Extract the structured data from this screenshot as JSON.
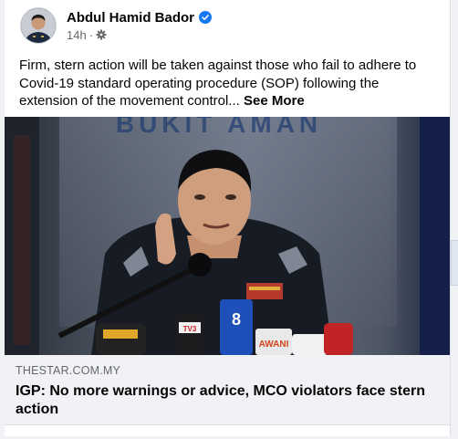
{
  "post": {
    "author": "Abdul Hamid Bador",
    "time": "14h",
    "separator": "·",
    "text": "Firm, stern action will be taken against those who fail to adhere to Covid-19 standard operating procedure (SOP) following the extension of the movement control...",
    "see_more": "See More"
  },
  "photo": {
    "signage_text": "BUKIT AMAN",
    "mic_labels": [
      "8",
      "TV3",
      "AWANI"
    ]
  },
  "link_preview": {
    "domain": "THESTAR.COM.MY",
    "title": "IGP: No more warnings or advice, MCO violators face stern action"
  },
  "icons": {
    "verified": "verified-badge-icon",
    "audience": "gear-icon"
  },
  "colors": {
    "verified_blue": "#1877f2",
    "footer_bg": "#f0f2f5",
    "secondary_text": "#65676b"
  }
}
